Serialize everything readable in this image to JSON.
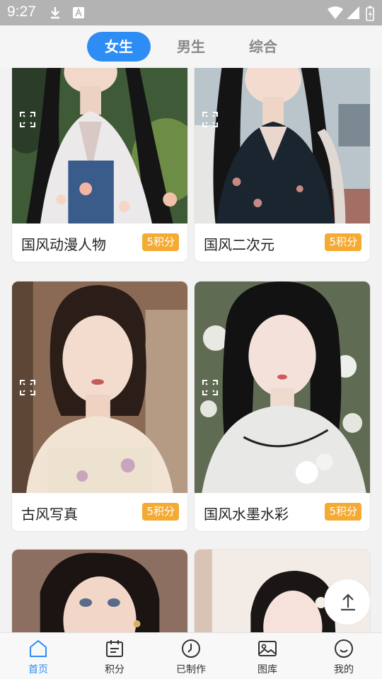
{
  "status_bar": {
    "time": "9:27"
  },
  "tabs": [
    {
      "label": "女生",
      "active": true
    },
    {
      "label": "男生",
      "active": false
    },
    {
      "label": "综合",
      "active": false
    }
  ],
  "cards": [
    {
      "title": "国风动漫人物",
      "points": "5积分"
    },
    {
      "title": "国风二次元",
      "points": "5积分"
    },
    {
      "title": "古风写真",
      "points": "5积分"
    },
    {
      "title": "国风水墨水彩",
      "points": "5积分"
    }
  ],
  "bottom_nav": [
    {
      "label": "首页",
      "icon": "home-icon",
      "active": true
    },
    {
      "label": "积分",
      "icon": "calendar-icon",
      "active": false
    },
    {
      "label": "已制作",
      "icon": "clock-icon",
      "active": false
    },
    {
      "label": "图库",
      "icon": "image-icon",
      "active": false
    },
    {
      "label": "我的",
      "icon": "smile-icon",
      "active": false
    }
  ],
  "colors": {
    "accent": "#2e8df5",
    "badge": "#f4aa33"
  }
}
